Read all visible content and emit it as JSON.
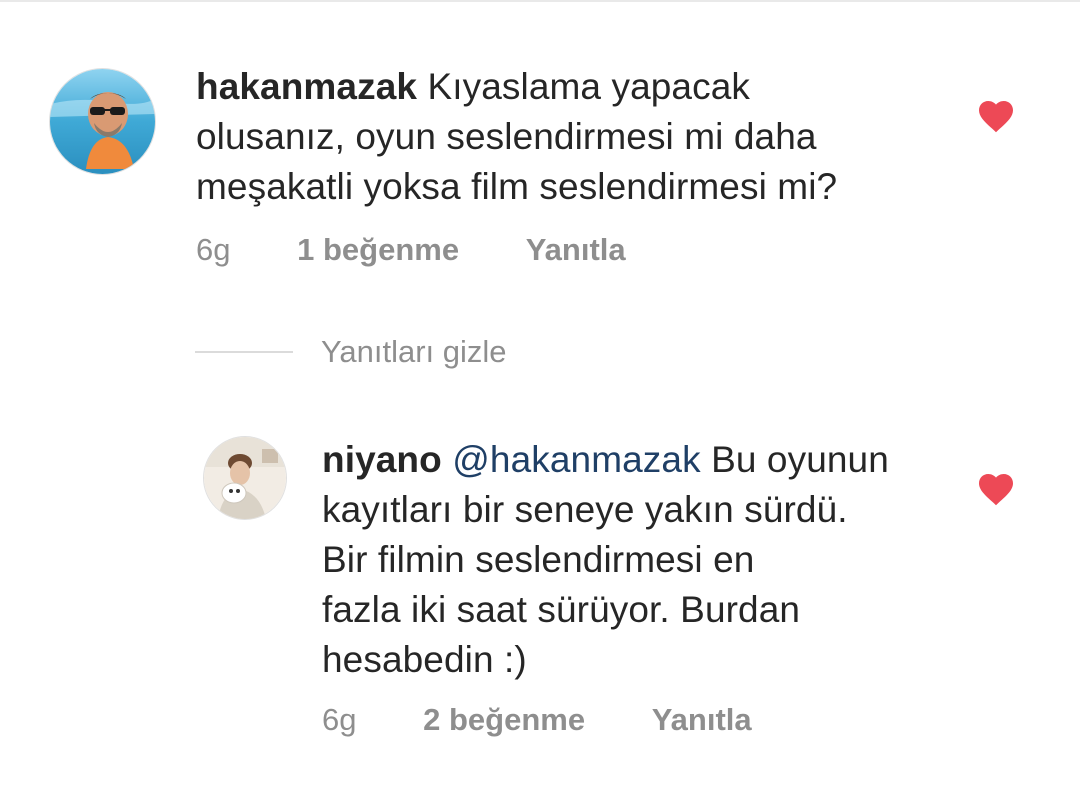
{
  "comments": [
    {
      "username": "hakanmazak",
      "text_lines": [
        "Kıyaslama yapacak",
        "olusanız, oyun seslendirmesi mi daha",
        "meşakatli yoksa film seslendirmesi mi?"
      ],
      "time": "6g",
      "likes": "1 beğenme",
      "reply_label": "Yanıtla",
      "liked": true,
      "heart_icon": "heart-filled-icon"
    }
  ],
  "replies_toggle": {
    "label": "Yanıtları gizle"
  },
  "replies": [
    {
      "username": "niyano",
      "mention": "@hakanmazak",
      "text_first": "Bu oyunun",
      "text_lines": [
        "kayıtları bir seneye yakın sürdü.",
        "Bir filmin seslendirmesi en",
        "fazla iki saat sürüyor. Burdan",
        "hesabedin :)"
      ],
      "time": "6g",
      "likes": "2 beğenme",
      "reply_label": "Yanıtla",
      "liked": true,
      "heart_icon": "heart-filled-icon"
    }
  ],
  "colors": {
    "heart": "#ed4956",
    "meta_text": "#8e8e8e",
    "mention": "#1f3f66",
    "body_text": "#262626"
  }
}
